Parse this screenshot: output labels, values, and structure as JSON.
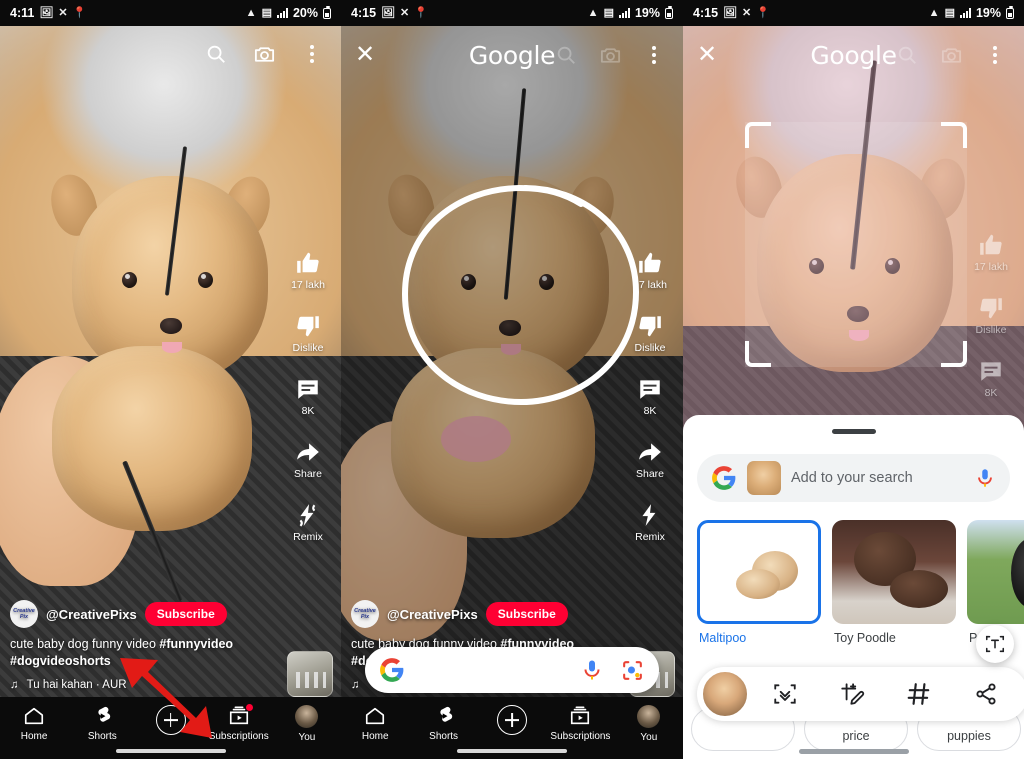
{
  "panels": [
    {
      "id": "youtube-shorts",
      "status": {
        "time": "4:11",
        "battery": "20%",
        "icons": [
          "image-icon",
          "close-icon",
          "location-icon",
          "wifi-icon",
          "vo-lte-icon",
          "signal-icon",
          "battery-icon"
        ]
      },
      "header": {
        "search": "search-icon",
        "camera": "camera-icon",
        "more": "more-vertical-icon"
      },
      "rail": [
        {
          "icon": "thumbs-up-icon",
          "label": "17 lakh"
        },
        {
          "icon": "thumbs-down-icon",
          "label": "Dislike"
        },
        {
          "icon": "comment-icon",
          "label": "8K"
        },
        {
          "icon": "share-icon",
          "label": "Share"
        },
        {
          "icon": "remix-icon",
          "label": "Remix"
        }
      ],
      "channel": {
        "avatar_line1": "Creative",
        "avatar_line2": "Pix",
        "handle": "@CreativePixs",
        "subscribe": "Subscribe"
      },
      "caption_plain": "cute baby dog funny video ",
      "caption_tag1": "#funnyvideo",
      "caption_tag2": "#dogvideoshorts",
      "music": "Tu hai kahan · AUR",
      "nav": [
        {
          "icon": "home-icon",
          "label": "Home"
        },
        {
          "icon": "shorts-icon",
          "label": "Shorts"
        },
        {
          "icon": "plus-icon",
          "label": ""
        },
        {
          "icon": "subscriptions-icon",
          "label": "Subscriptions"
        },
        {
          "icon": "avatar-icon",
          "label": "You"
        }
      ],
      "annotation": "red-arrow-pointing-to-create-button"
    },
    {
      "id": "circle-to-search",
      "status": {
        "time": "4:15",
        "battery": "19%"
      },
      "header": {
        "close": "✕",
        "brand": "Google",
        "search": "search-icon",
        "camera": "camera-icon",
        "more": "more-vertical-icon"
      },
      "gesture": "hand-drawn-circle-around-puppy-face",
      "searchbar": {
        "google_logo": "google-g-icon",
        "value": "",
        "placeholder": "",
        "mic": "mic-icon",
        "lens": "lens-icon"
      }
    },
    {
      "id": "lens-results",
      "status": {
        "time": "4:15",
        "battery": "19%"
      },
      "header": {
        "close": "✕",
        "brand": "Google",
        "more": "more-vertical-icon"
      },
      "selection": "crop-box-around-puppy-face",
      "add_search": {
        "placeholder": "Add to your search",
        "google_logo": "google-g-icon",
        "thumb": "query-thumbnail",
        "mic": "mic-icon"
      },
      "results": [
        {
          "label": "Maltipoo",
          "selected": true
        },
        {
          "label": "Toy Poodle",
          "selected": false
        },
        {
          "label": "Pood",
          "selected": false
        }
      ],
      "text_fab": "text-select-icon",
      "chips": [
        "price",
        "puppies"
      ],
      "toolbar": [
        {
          "icon": "query-thumbnail-icon",
          "label": ""
        },
        {
          "icon": "visual-search-icon",
          "label": ""
        },
        {
          "icon": "add-to-search-icon",
          "label": ""
        },
        {
          "icon": "hashtag-icon",
          "label": ""
        },
        {
          "icon": "share-icon",
          "label": ""
        }
      ]
    }
  ],
  "colors": {
    "youtube_red": "#ff0033",
    "google_blue": "#1a73e8",
    "sheet_bg": "#ffffff",
    "chip_bg": "#f1f3f4",
    "status_bg": "#0b0b0b",
    "arrow_red": "#e21b16"
  }
}
